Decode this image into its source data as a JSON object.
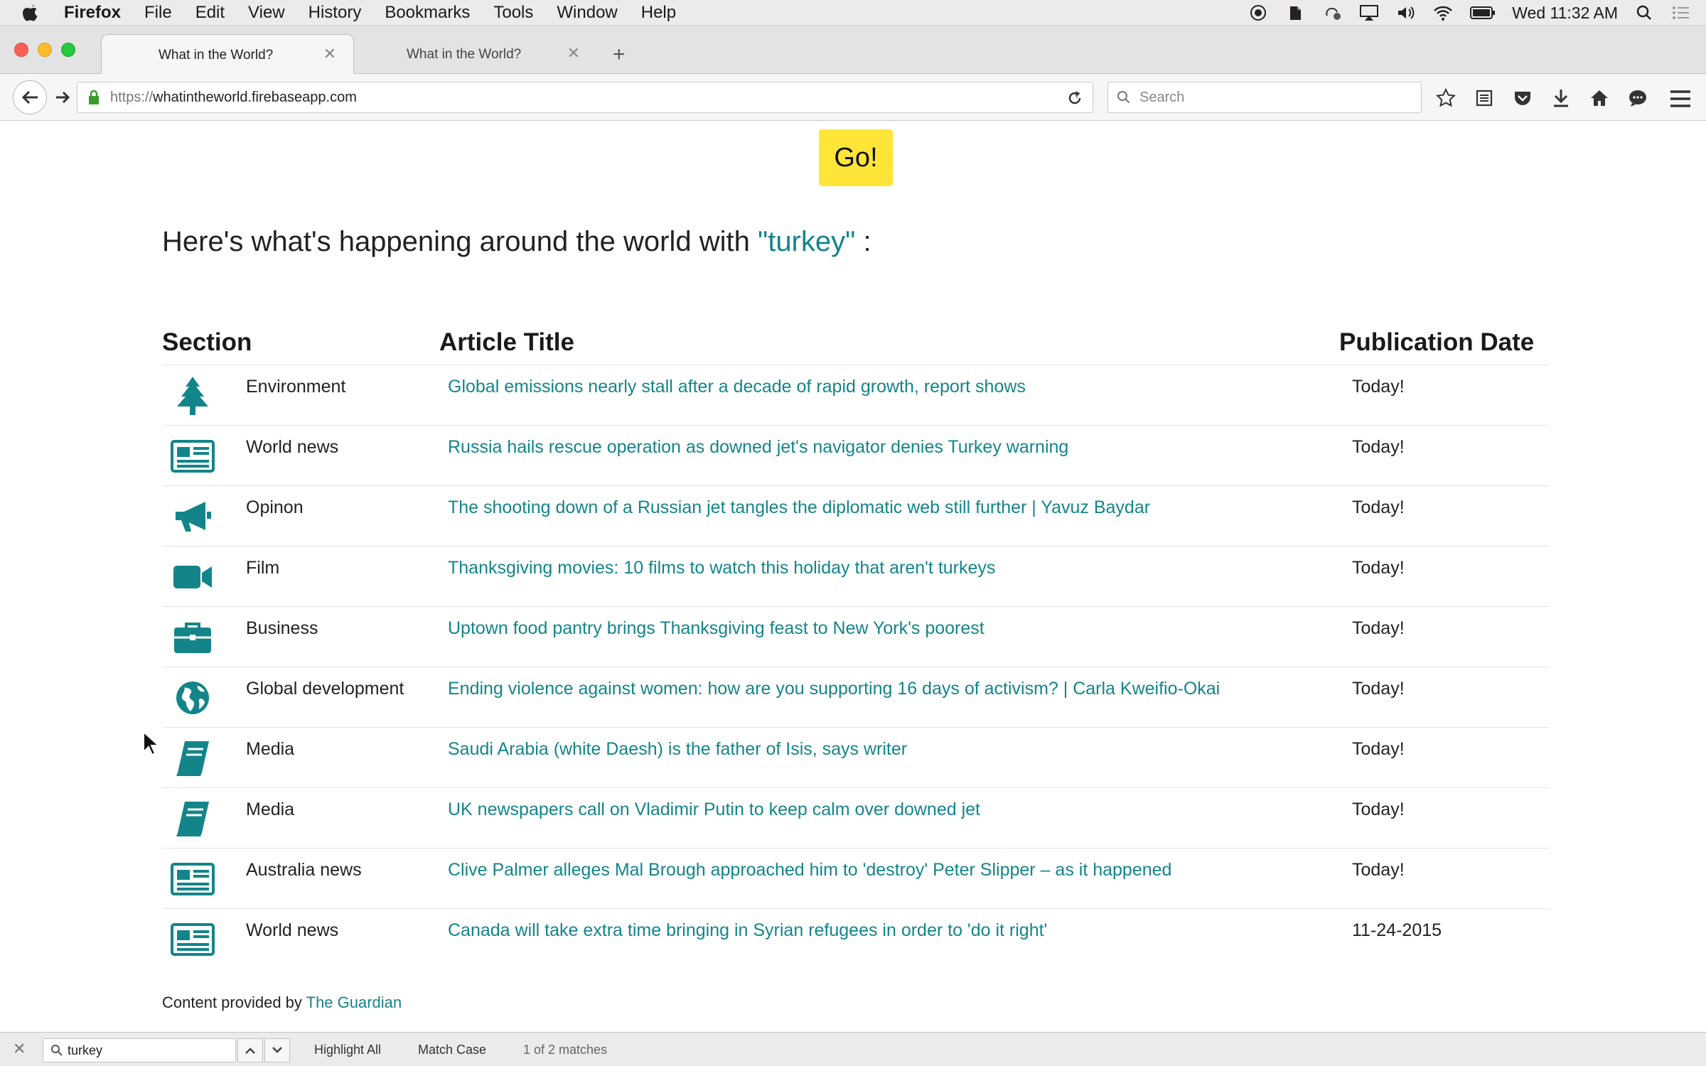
{
  "menubar": {
    "app": "Firefox",
    "items": [
      "File",
      "Edit",
      "View",
      "History",
      "Bookmarks",
      "Tools",
      "Window",
      "Help"
    ],
    "clock": "Wed 11:32 AM"
  },
  "tabs": [
    {
      "title": "What in the World?",
      "active": true
    },
    {
      "title": "What in the World?",
      "active": false
    }
  ],
  "navbar": {
    "url_prefix": "https://",
    "url_host": "whatintheworld.firebaseapp.com",
    "search_placeholder": "Search"
  },
  "page": {
    "go_label": "Go!",
    "headline_prefix": "Here's what's happening around the world with ",
    "keyword": "\"turkey\"",
    "headline_suffix": " :",
    "columns": {
      "section": "Section",
      "title": "Article Title",
      "date": "Publication Date"
    },
    "rows": [
      {
        "icon": "tree-icon",
        "section": "Environment",
        "title": "Global emissions nearly stall after a decade of rapid growth, report shows",
        "date": "Today!"
      },
      {
        "icon": "newspaper-icon",
        "section": "World news",
        "title": "Russia hails rescue operation as downed jet's navigator denies Turkey warning",
        "date": "Today!"
      },
      {
        "icon": "megaphone-icon",
        "section": "Opinon",
        "title": "The shooting down of a Russian jet tangles the diplomatic web still further | Yavuz Baydar",
        "date": "Today!"
      },
      {
        "icon": "video-camera-icon",
        "section": "Film",
        "title": "Thanksgiving movies: 10 films to watch this holiday that aren't turkeys",
        "date": "Today!"
      },
      {
        "icon": "briefcase-icon",
        "section": "Business",
        "title": "Uptown food pantry brings Thanksgiving feast to New York's poorest",
        "date": "Today!"
      },
      {
        "icon": "globe-icon",
        "section": "Global development",
        "title": "Ending violence against women: how are you supporting 16 days of activism? | Carla Kweifio-Okai",
        "date": "Today!"
      },
      {
        "icon": "book-icon",
        "section": "Media",
        "title": "Saudi Arabia (white Daesh) is the father of Isis, says writer",
        "date": "Today!"
      },
      {
        "icon": "book-icon",
        "section": "Media",
        "title": "UK newspapers call on Vladimir Putin to keep calm over downed jet",
        "date": "Today!"
      },
      {
        "icon": "newspaper-icon",
        "section": "Australia news",
        "title": "Clive Palmer alleges Mal Brough approached him to 'destroy' Peter Slipper – as it happened",
        "date": "Today!"
      },
      {
        "icon": "newspaper-icon",
        "section": "World news",
        "title": "Canada will take extra time bringing in Syrian refugees in order to 'do it right'",
        "date": "11-24-2015"
      }
    ],
    "footer_prefix": "Content provided by ",
    "footer_link": "The Guardian"
  },
  "findbar": {
    "query": "turkey",
    "highlight_all": "Highlight All",
    "match_case": "Match Case",
    "matches": "1 of 2 matches"
  },
  "colors": {
    "accent": "#13858a",
    "go_button": "#ffe537"
  }
}
